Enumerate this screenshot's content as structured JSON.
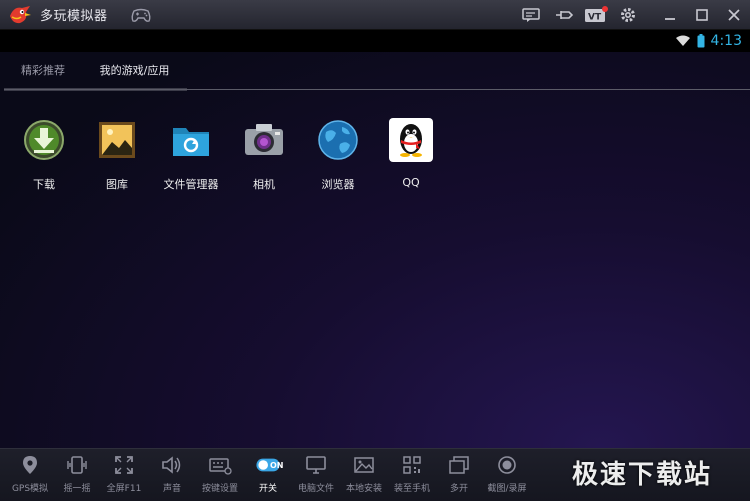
{
  "window": {
    "title": "多玩模拟器"
  },
  "status_bar": {
    "time": "4:13"
  },
  "tabs": [
    {
      "label": "精彩推荐"
    },
    {
      "label": "我的游戏/应用"
    }
  ],
  "apps": [
    {
      "label": "下载",
      "icon": "download-icon"
    },
    {
      "label": "图库",
      "icon": "gallery-icon"
    },
    {
      "label": "文件管理器",
      "icon": "folder-icon"
    },
    {
      "label": "相机",
      "icon": "camera-icon"
    },
    {
      "label": "浏览器",
      "icon": "globe-icon"
    },
    {
      "label": "QQ",
      "icon": "qq-penguin-icon"
    }
  ],
  "toolbar": {
    "items": [
      {
        "label": "GPS模拟",
        "icon": "location-pin-icon"
      },
      {
        "label": "摇一摇",
        "icon": "shake-icon"
      },
      {
        "label": "全屏F11",
        "icon": "fullscreen-icon"
      },
      {
        "label": "声音",
        "icon": "speaker-icon"
      },
      {
        "label": "按键设置",
        "icon": "keyboard-icon"
      },
      {
        "label": "开关",
        "icon": "toggle-icon",
        "toggle_text": "ON"
      },
      {
        "label": "电脑文件",
        "icon": "monitor-icon"
      },
      {
        "label": "本地安装",
        "icon": "image-install-icon"
      },
      {
        "label": "装至手机",
        "icon": "qr-icon"
      },
      {
        "label": "多开",
        "icon": "multi-window-icon"
      },
      {
        "label": "截图/录屏",
        "icon": "record-icon"
      }
    ]
  },
  "watermark": {
    "text": "极速下载站"
  },
  "colors": {
    "accent_blue": "#33b5e5",
    "toggle_blue": "#3aa6e6"
  }
}
